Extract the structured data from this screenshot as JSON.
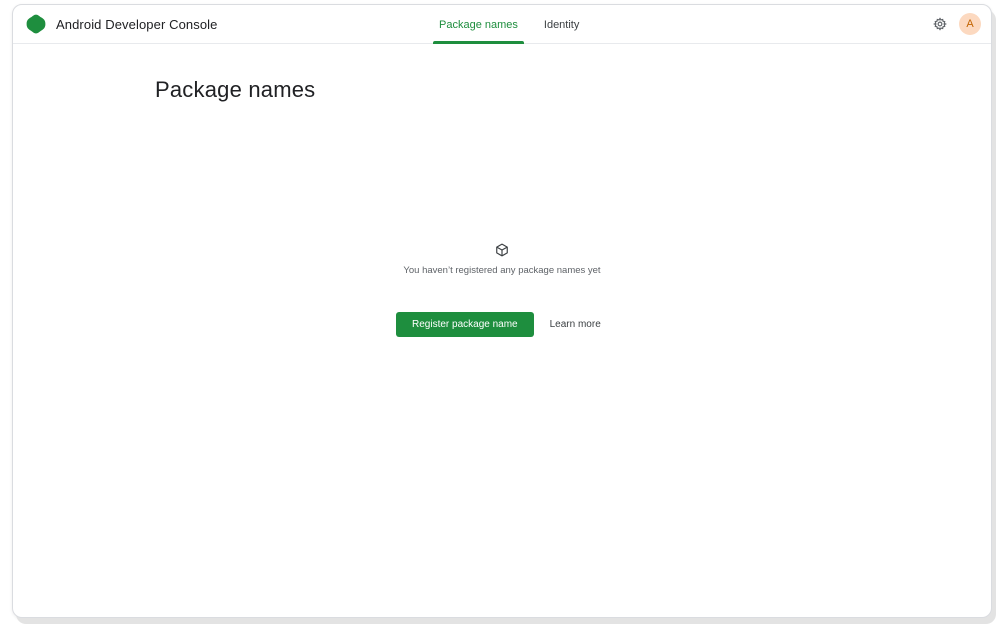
{
  "app": {
    "title": "Android Developer Console",
    "brand_color": "#1e8e3e"
  },
  "tabs": [
    {
      "label": "Package names",
      "active": true
    },
    {
      "label": "Identity",
      "active": false
    }
  ],
  "header": {
    "settings_icon": "gear-icon",
    "avatar_initial": "A",
    "avatar_bg": "#fcd9c0"
  },
  "main": {
    "title": "Package names",
    "empty_state": {
      "icon": "package-box-icon",
      "message": "You haven’t registered any package names yet",
      "primary_button": "Register package name",
      "secondary_link": "Learn more"
    }
  }
}
